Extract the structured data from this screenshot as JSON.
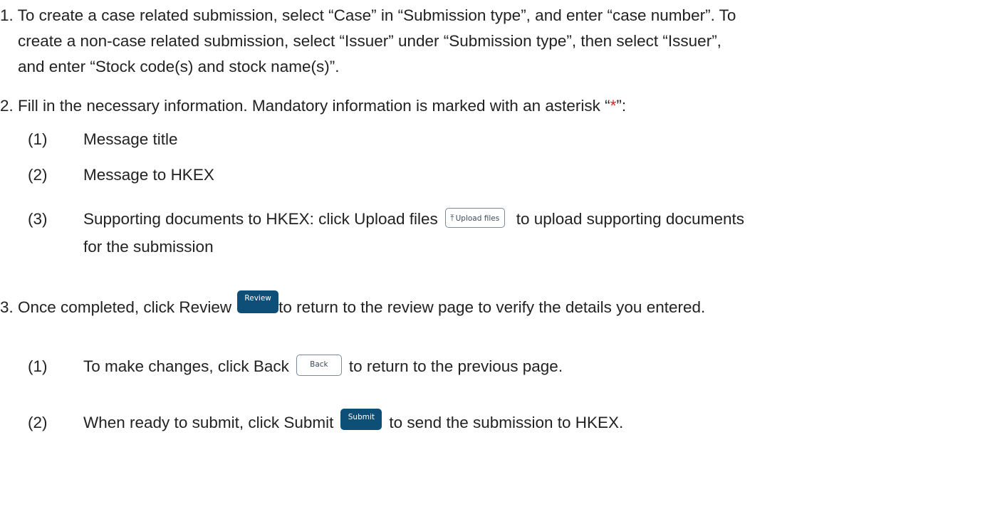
{
  "steps": [
    {
      "number": "1.",
      "lines": [
        "To create a case related submission, select “Case” in “Submission type”, and enter “case number”. To",
        "create a non-case related submission, select “Issuer” under “Submission type”, then select “Issuer”,",
        "and enter “Stock code(s) and stock name(s)”."
      ]
    },
    {
      "number": "2.",
      "text_before_star": "Fill in the necessary information. Mandatory information is marked with an asterisk “",
      "star": "*",
      "text_after_star": "”:",
      "substeps": [
        {
          "number": "(1)",
          "text": "Message title"
        },
        {
          "number": "(2)",
          "text": "Message to HKEX"
        },
        {
          "number": "(3)",
          "text_before_button": "Supporting documents to HKEX: click Upload files",
          "button_label": "Upload files",
          "button_icon": "upload-icon",
          "text_after_button": "to upload supporting documents",
          "continuation": "for the submission"
        }
      ]
    },
    {
      "number": "3.",
      "text_before_button": "Once completed, click Review",
      "button_label": "Review",
      "text_after_button": "to return to the review page to verify the details you entered.",
      "substeps": [
        {
          "number": "(1)",
          "text_before_button": "To make changes, click Back",
          "button_label": "Back",
          "text_after_button": "to return to the previous page."
        },
        {
          "number": "(2)",
          "text_before_button": "When ready to submit, click Submit",
          "button_label": "Submit",
          "text_after_button": "to send the submission to HKEX."
        }
      ]
    }
  ],
  "colors": {
    "text": "#222222",
    "asterisk": "#e02020",
    "primary_button": "#0e4f78",
    "outline_button_border": "#7a8a9a"
  }
}
